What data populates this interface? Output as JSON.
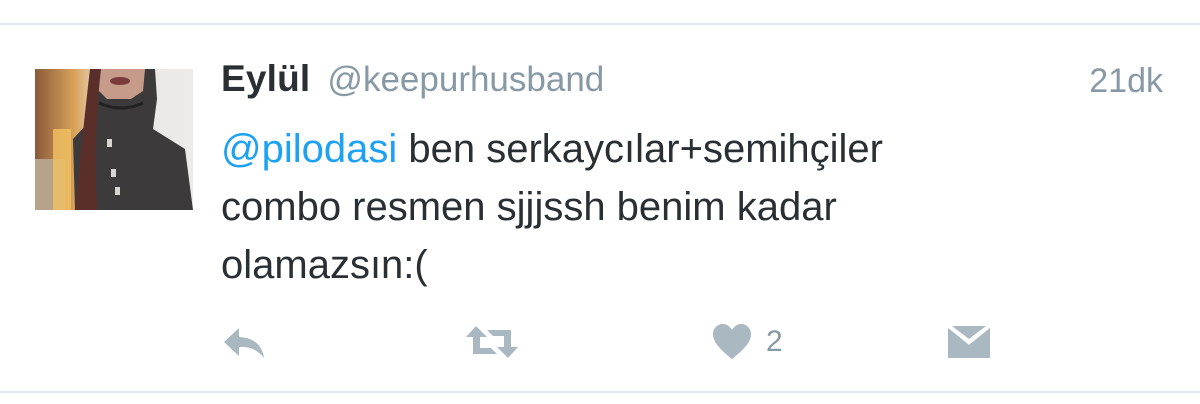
{
  "tweet": {
    "display_name": "Eylül",
    "handle": "@keepurhusband",
    "timestamp": "21dk",
    "mention": "@pilodasi",
    "text_line1_rest": " ben serkaycılar+semihçiler",
    "text_line2": "combo resmen sjjjssh benim kadar",
    "text_line3": "olamazsın:("
  },
  "actions": {
    "reply_icon": "reply-icon",
    "retweet_icon": "retweet-icon",
    "like_icon": "heart-icon",
    "like_count": "2",
    "dm_icon": "envelope-icon"
  },
  "colors": {
    "text": "#292f33",
    "muted": "#8899a6",
    "mention": "#1da1f2",
    "icon": "#aab8c2",
    "divider": "#e3e7ea"
  }
}
